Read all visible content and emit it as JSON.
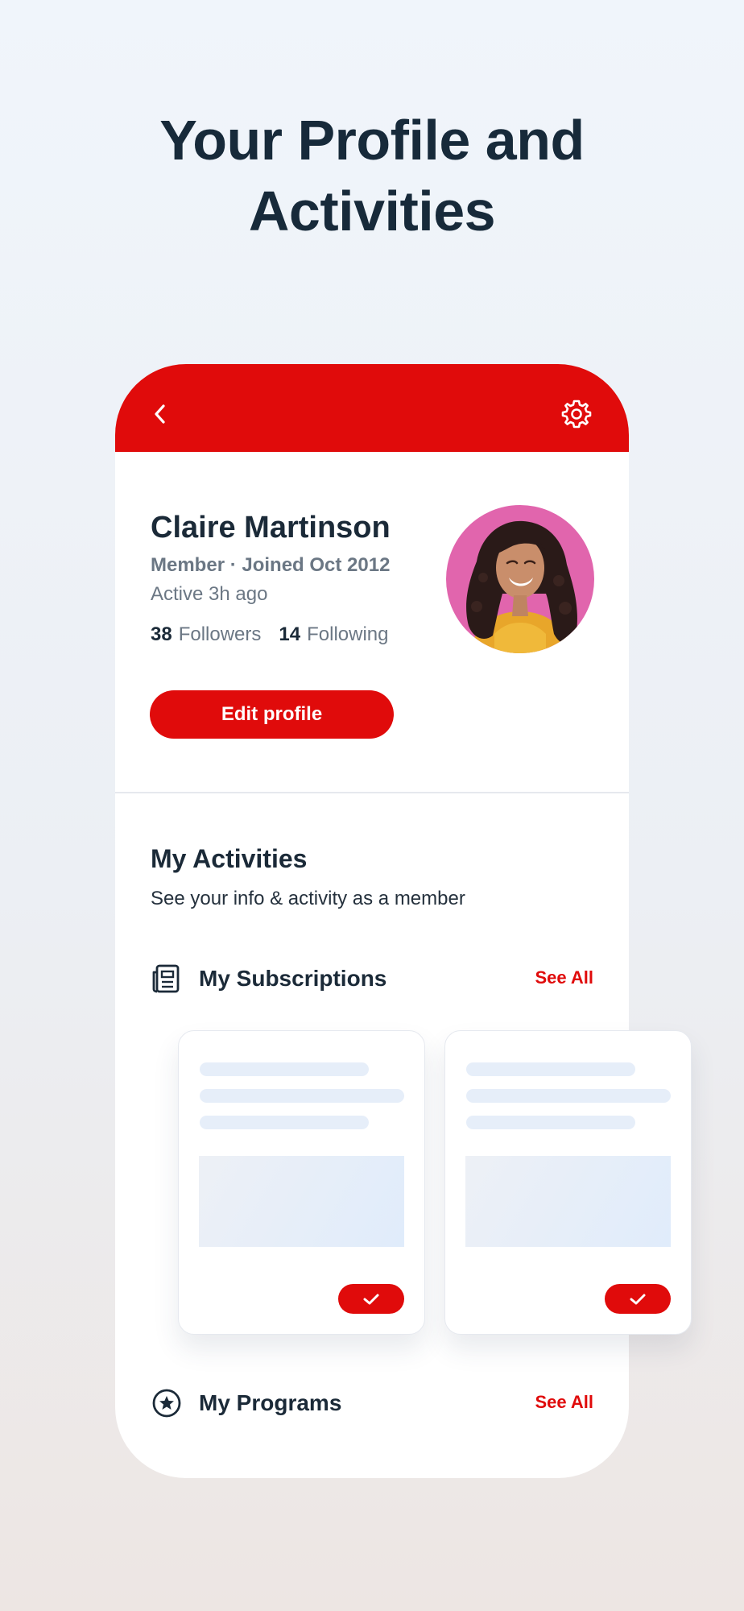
{
  "headline": {
    "line1": "Your Profile and",
    "line2": "Activities"
  },
  "header": {
    "back_icon": "chevron-left-icon",
    "settings_icon": "gear-icon"
  },
  "profile": {
    "name": "Claire Martinson",
    "meta": "Member · Joined Oct 2012",
    "active": "Active 3h ago",
    "followers_count": "38",
    "followers_label": "Followers",
    "following_count": "14",
    "following_label": "Following",
    "edit_label": "Edit profile"
  },
  "activities": {
    "title": "My Activities",
    "subtitle": "See your info & activity as a member",
    "subscriptions_label": "My Subscriptions",
    "subscriptions_see_all": "See All",
    "programs_label": "My Programs",
    "programs_see_all": "See All"
  },
  "colors": {
    "brand": "#e00b0b",
    "text": "#1b2a38",
    "muted": "#6b7784"
  }
}
